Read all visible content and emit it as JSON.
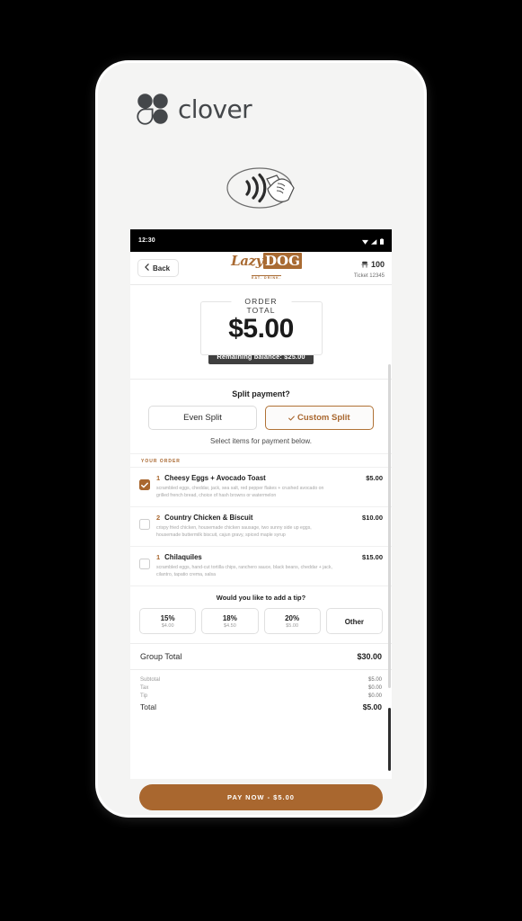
{
  "brand": {
    "name": "clover",
    "logo_icon": "clover-leaf-icon",
    "nfc_icon": "contactless-payment-icon"
  },
  "statusbar": {
    "clock": "12:30",
    "icons": [
      "wifi-icon",
      "signal-icon",
      "battery-icon"
    ]
  },
  "header": {
    "back_label": "Back",
    "back_icon": "chevron-left-icon",
    "merchant_logo_main": "Lazy",
    "merchant_logo_badge": "DOG",
    "merchant_logo_sub": "EAT. DRINK.",
    "guest_icon": "table-chair-icon",
    "guest_count": "100",
    "ticket": "Ticket 12345"
  },
  "order_total": {
    "label": "ORDER TOTAL",
    "amount": "$5.00",
    "remaining_balance": "Remaining balance: $25.00"
  },
  "split": {
    "question": "Split payment?",
    "even_label": "Even Split",
    "custom_label": "Custom Split",
    "custom_check_icon": "check-icon",
    "active": "custom",
    "help": "Select items for payment below."
  },
  "order": {
    "section_label": "YOUR ORDER",
    "items": [
      {
        "qty": "1",
        "name": "Cheesy Eggs + Avocado Toast",
        "price": "$5.00",
        "desc": "scrambled eggs, cheddar, jack, sea salt, red pepper flakes + crushed avocado on grilled french bread, choice of hash browns or watermelon",
        "selected": true
      },
      {
        "qty": "2",
        "name": "Country Chicken & Biscuit",
        "price": "$10.00",
        "desc": "crispy fried chicken, housemade chicken sausage, two sunny side up eggs, housemade buttermilk biscuit, cajun gravy, spiced maple syrup",
        "selected": false
      },
      {
        "qty": "1",
        "name": "Chilaquiles",
        "price": "$15.00",
        "desc": "scrambled eggs, hand-cut tortilla chips, ranchero sauce, black beans, cheddar + jack, cilantro, tapatio crema, salsa",
        "selected": false
      }
    ]
  },
  "tip": {
    "question": "Would you like to add a tip?",
    "options": [
      {
        "percent": "15%",
        "amount": "$4.00"
      },
      {
        "percent": "18%",
        "amount": "$4.50"
      },
      {
        "percent": "20%",
        "amount": "$5.00"
      }
    ],
    "other_label": "Other"
  },
  "totals": {
    "group_total_label": "Group Total",
    "group_total_value": "$30.00",
    "rows": [
      {
        "label": "Subtotal",
        "value": "$5.00"
      },
      {
        "label": "Tax",
        "value": "$0.00"
      },
      {
        "label": "Tip",
        "value": "$0.00"
      }
    ],
    "final_label": "Total",
    "final_value": "$5.00"
  },
  "pay": {
    "label": "PAY NOW - $5.00"
  },
  "colors": {
    "brand_brown": "#a9672f",
    "dark": "#1d1d1d",
    "balance_bg": "#3f3f3f",
    "device": "#f4f4f3"
  }
}
